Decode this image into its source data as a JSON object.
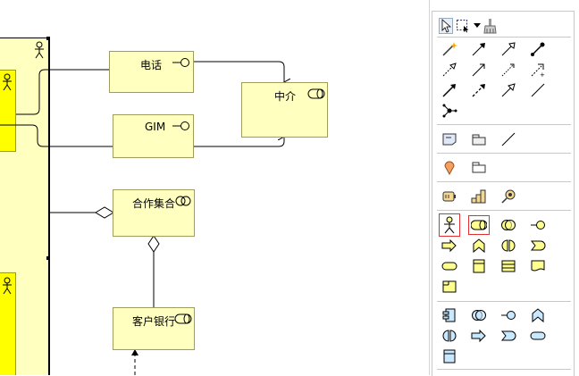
{
  "diagram": {
    "nodes": {
      "phone": {
        "label": "电话"
      },
      "gim": {
        "label": "GIM"
      },
      "broker": {
        "label": "中介"
      },
      "cooperation": {
        "label": "合作集合"
      },
      "bank": {
        "label": "客户银行"
      }
    }
  },
  "palette": {
    "toolbar_icons": [
      "select-arrow-icon",
      "marquee-select-icon",
      "dropdown-arrow-icon",
      "format-painter-icon"
    ],
    "selected_items": [
      "actor-tool",
      "role-tool"
    ]
  },
  "colors": {
    "node_fill": "#ffffc0",
    "actor_fill": "#ffff00",
    "selection": "#e03030"
  }
}
